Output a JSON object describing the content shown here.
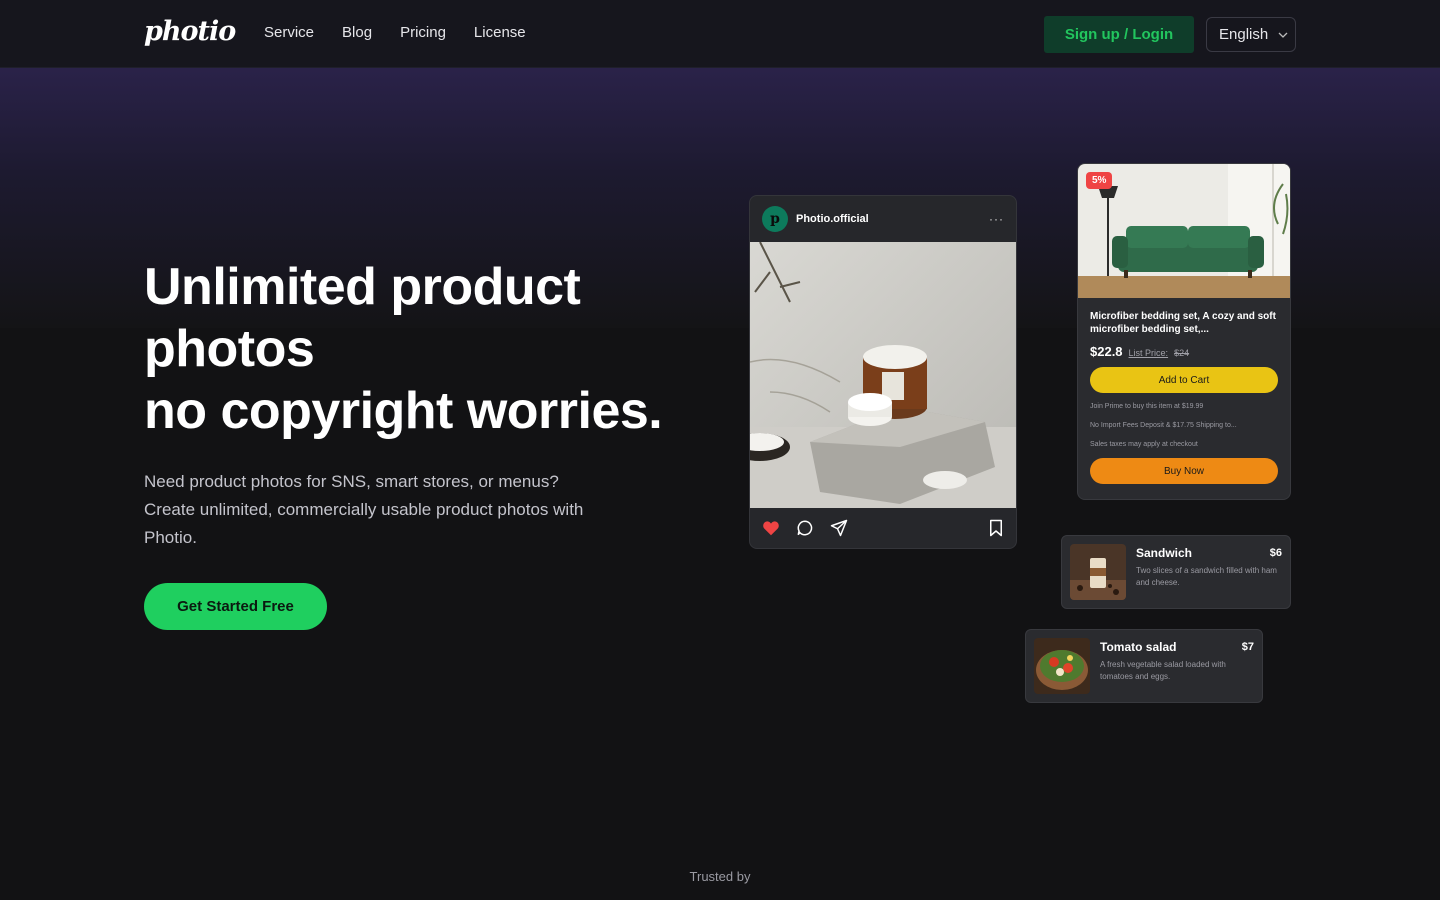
{
  "header": {
    "logo": "photio",
    "nav": [
      "Service",
      "Blog",
      "Pricing",
      "License"
    ],
    "signup_label": "Sign up / Login",
    "language": "English"
  },
  "hero": {
    "title_lines": [
      "Unlimited product",
      "photos",
      "no copyright worries."
    ],
    "subtitle_lines": [
      "Need product photos for SNS, smart stores, or menus?",
      "Create unlimited, commercially usable product photos with",
      "Photio."
    ],
    "cta_label": "Get Started Free"
  },
  "insta_card": {
    "avatar_letter": "p",
    "handle": "Photio.official",
    "more": "···"
  },
  "product_card": {
    "badge": "5%",
    "name": "Microfiber bedding set, A cozy and soft microfiber bedding set,...",
    "price": "$22.8",
    "list_label": "List Price:",
    "list_price": "$24",
    "add_to_cart": "Add to Cart",
    "fine_print": [
      "Join Prime to buy this item at $19.99",
      "No Import Fees Deposit & $17.75 Shipping to...",
      "Sales taxes may apply at checkout"
    ],
    "buy_now": "Buy Now"
  },
  "menu_items": [
    {
      "name": "Sandwich",
      "price": "$6",
      "desc": "Two slices of a sandwich filled with ham and cheese."
    },
    {
      "name": "Tomato salad",
      "price": "$7",
      "desc": "A fresh vegetable salad loaded with tomatoes and eggs."
    }
  ],
  "footer": {
    "trusted_by": "Trusted by"
  },
  "colors": {
    "background": "#121214",
    "accent_green": "#1fcf5f",
    "cart_yellow": "#e9c414",
    "buy_orange": "#ee8a14",
    "like_red": "#ef4444"
  },
  "icons": [
    "heart-icon",
    "comment-icon",
    "share-icon",
    "bookmark-icon",
    "chevron-down-icon"
  ]
}
